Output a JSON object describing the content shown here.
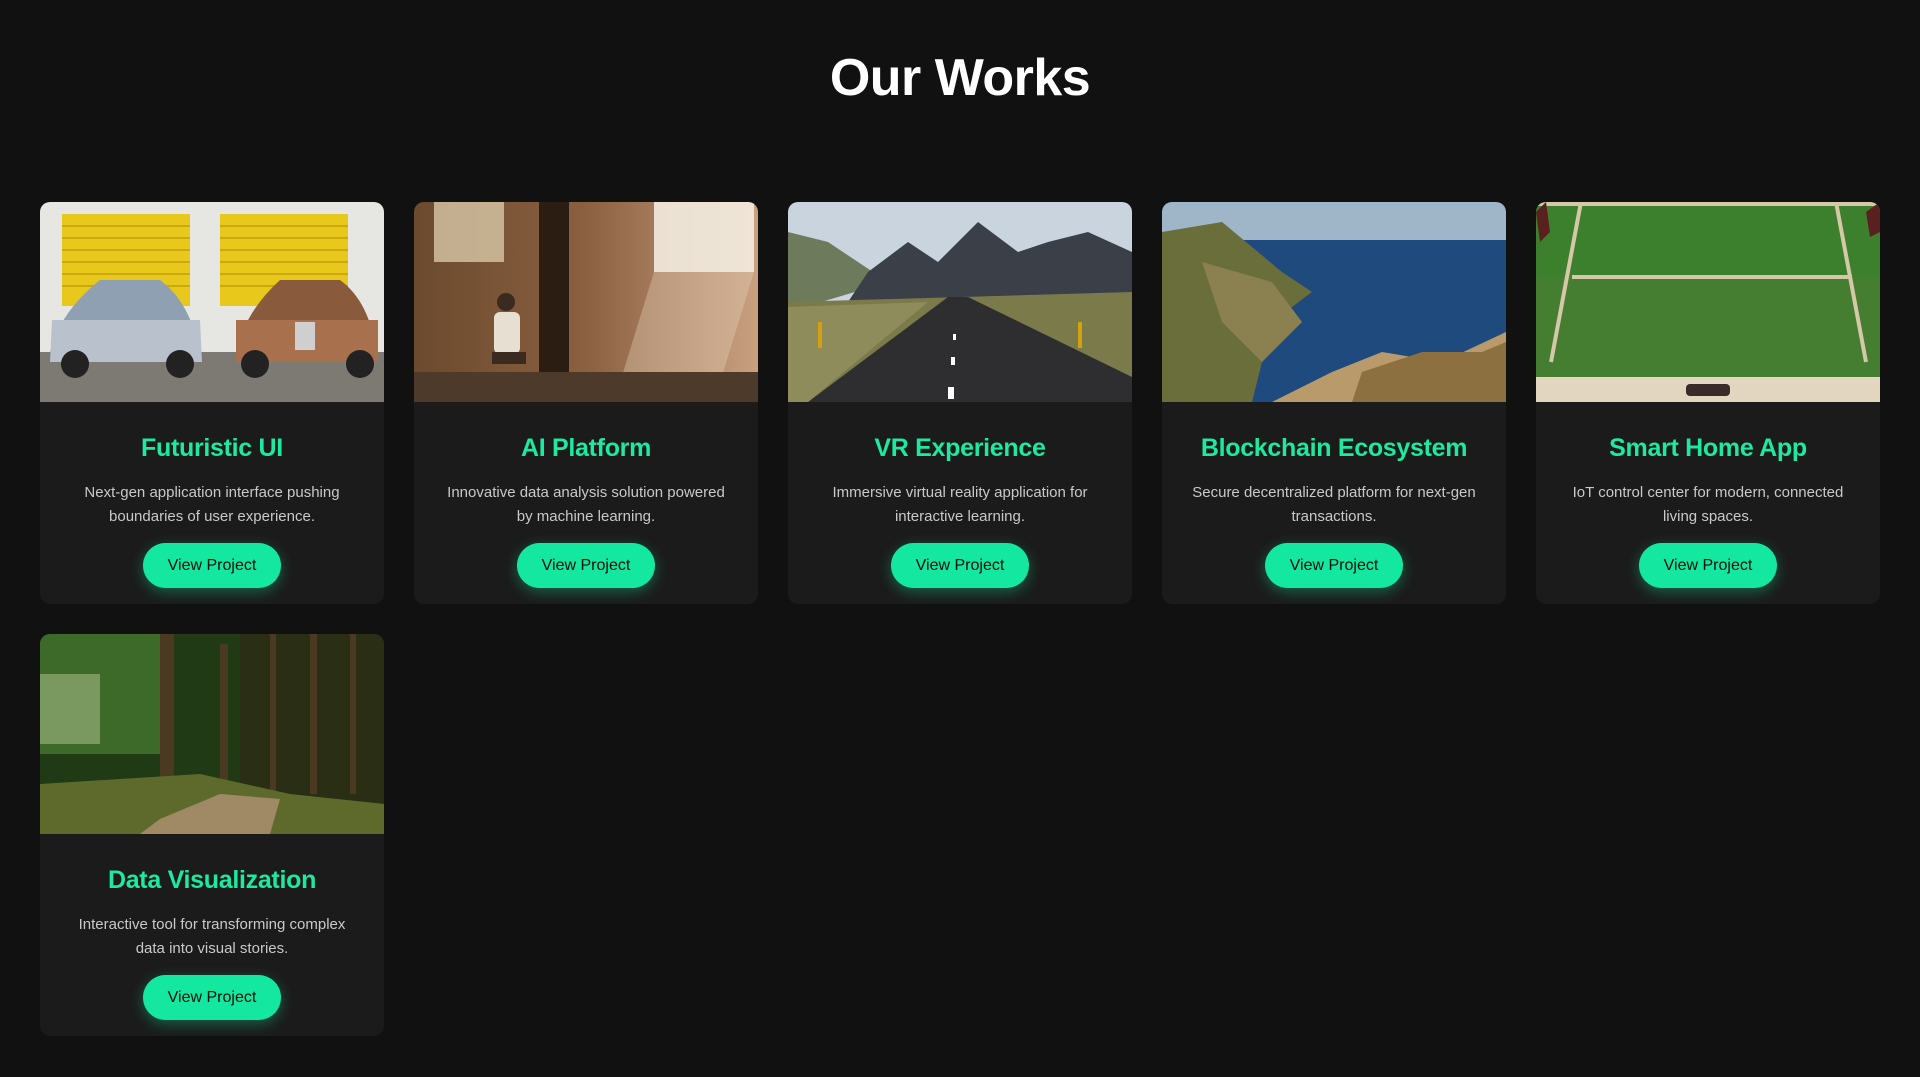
{
  "page": {
    "title": "Our Works"
  },
  "colors": {
    "background": "#111111",
    "card": "#1b1b1b",
    "accent": "#14e8a0",
    "title_accent": "#1de9a0"
  },
  "projects": [
    {
      "title": "Futuristic UI",
      "description": "Next-gen application interface pushing boundaries of user experience.",
      "button_label": "View Project",
      "image": "vintage-cars-photo"
    },
    {
      "title": "AI Platform",
      "description": "Innovative data analysis solution powered by machine learning.",
      "button_label": "View Project",
      "image": "warehouse-light-photo"
    },
    {
      "title": "VR Experience",
      "description": "Immersive virtual reality application for interactive learning.",
      "button_label": "View Project",
      "image": "mountain-road-photo"
    },
    {
      "title": "Blockchain Ecosystem",
      "description": "Secure decentralized platform for next-gen transactions.",
      "button_label": "View Project",
      "image": "coastal-cliffs-photo"
    },
    {
      "title": "Smart Home App",
      "description": "IoT control center for modern, connected living spaces.",
      "button_label": "View Project",
      "image": "green-field-photo"
    },
    {
      "title": "Data Visualization",
      "description": "Interactive tool for transforming complex data into visual stories.",
      "button_label": "View Project",
      "image": "forest-path-photo"
    }
  ]
}
